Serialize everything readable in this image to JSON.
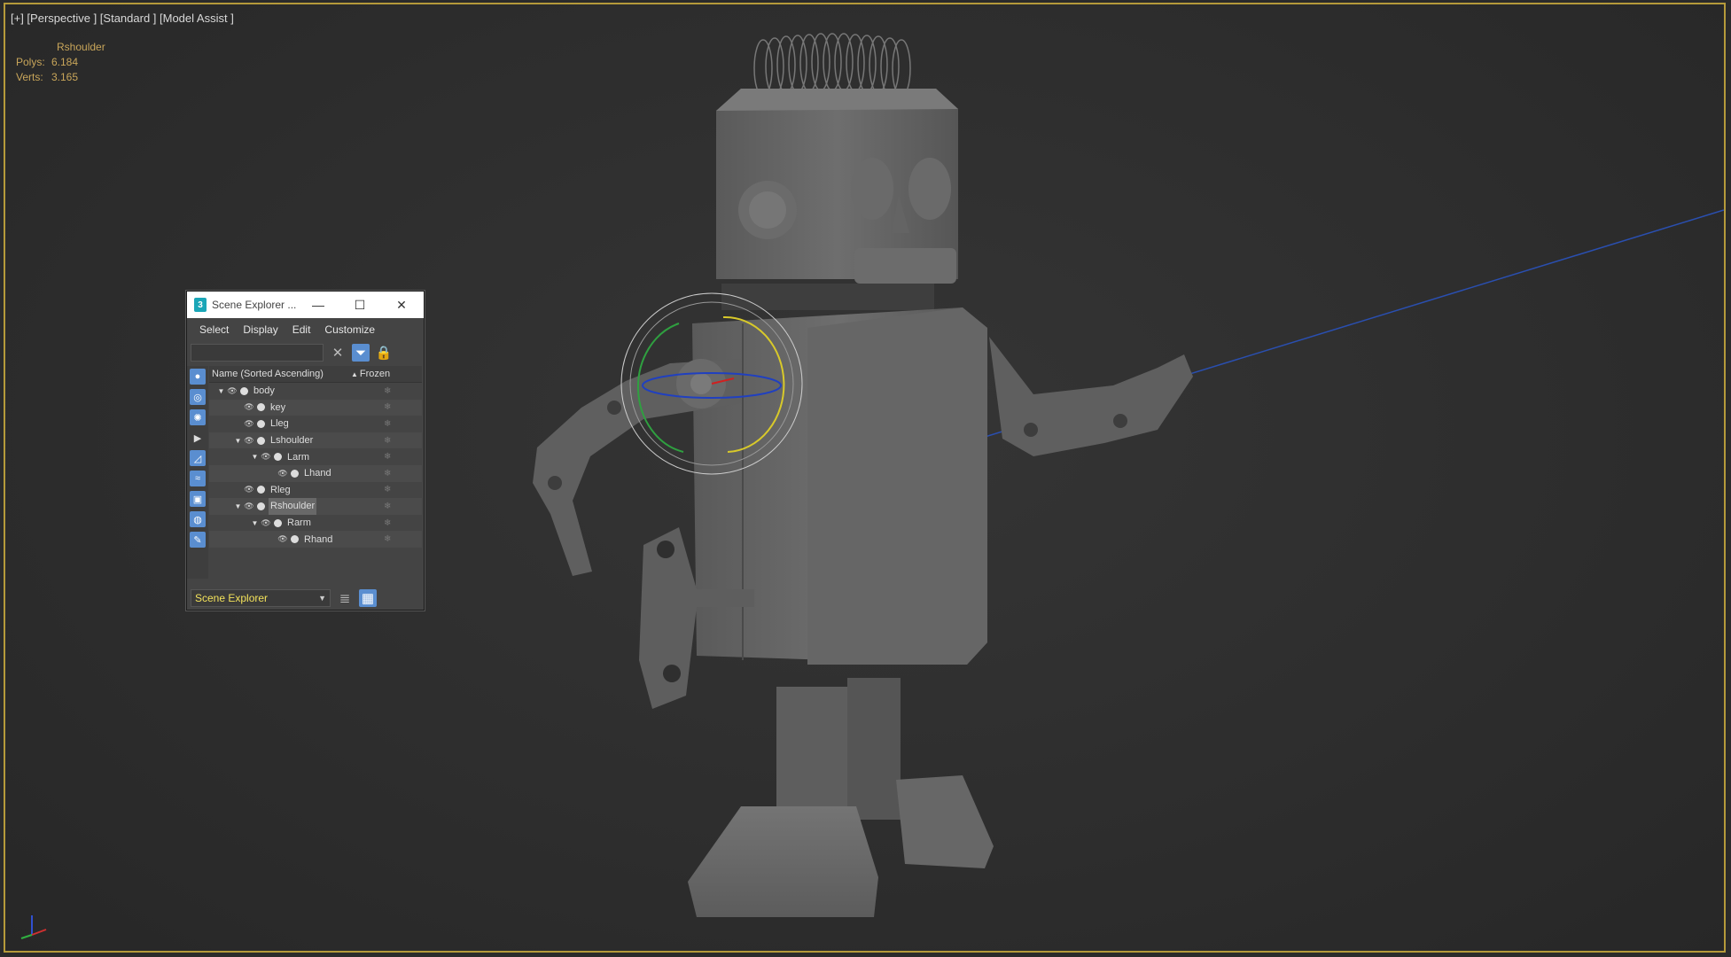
{
  "viewport": {
    "label": "[+] [Perspective ] [Standard ] [Model Assist ]",
    "selected_object": "Rshoulder",
    "stats": [
      {
        "key": "Polys:",
        "value": "6.184"
      },
      {
        "key": "Verts:",
        "value": "3.165"
      }
    ]
  },
  "scene_explorer": {
    "title": "Scene Explorer ...",
    "app_icon": "3",
    "window_buttons": {
      "minimize": "—",
      "maximize": "☐",
      "close": "✕"
    },
    "menu": [
      "Select",
      "Display",
      "Edit",
      "Customize"
    ],
    "search_value": "",
    "columns": {
      "name": "Name (Sorted Ascending)",
      "sort_indicator": "▲",
      "frozen": "Frozen"
    },
    "rows": [
      {
        "label": "body",
        "depth": 0,
        "expanded": true
      },
      {
        "label": "key",
        "depth": 1,
        "expanded": false
      },
      {
        "label": "Lleg",
        "depth": 1,
        "expanded": false
      },
      {
        "label": "Lshoulder",
        "depth": 1,
        "expanded": true
      },
      {
        "label": "Larm",
        "depth": 2,
        "expanded": true
      },
      {
        "label": "Lhand",
        "depth": 3,
        "expanded": false
      },
      {
        "label": "Rleg",
        "depth": 1,
        "expanded": false
      },
      {
        "label": "Rshoulder",
        "depth": 1,
        "expanded": true,
        "selected": true
      },
      {
        "label": "Rarm",
        "depth": 2,
        "expanded": true
      },
      {
        "label": "Rhand",
        "depth": 3,
        "expanded": false
      }
    ],
    "explorer_dropdown": "Scene Explorer"
  },
  "colors": {
    "viewport_border": "#b59a3a",
    "accent": "#5a8ed0",
    "stats_text": "#c9a65a",
    "dropdown_text": "#f3e25b"
  }
}
